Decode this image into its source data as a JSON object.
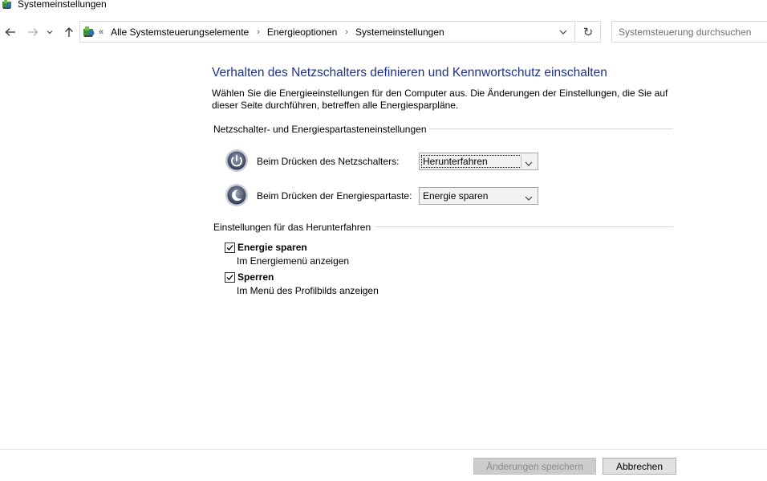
{
  "window": {
    "title": "Systemeinstellungen",
    "icon": "control-panel-icon"
  },
  "nav": {
    "back_icon": "back-arrow-icon",
    "forward_icon": "forward-arrow-icon",
    "recent_icon": "chevron-down-icon",
    "up_icon": "up-arrow-icon"
  },
  "address": {
    "overflow": "«",
    "crumbs": [
      "Alle Systemsteuerungselemente",
      "Energieoptionen",
      "Systemeinstellungen"
    ],
    "separator": "›"
  },
  "search": {
    "placeholder": "Systemsteuerung durchsuchen"
  },
  "refresh_glyph": "↻",
  "content": {
    "heading": "Verhalten des Netzschalters definieren und Kennwortschutz einschalten",
    "intro": "Wählen Sie die Energieeinstellungen für den Computer aus. Die Änderungen der Einstellungen, die Sie auf dieser Seite durchführen, betreffen alle Energiesparpläne.",
    "power_group": {
      "title": "Netzschalter- und Energiespartasteneinstellungen",
      "rows": [
        {
          "label": "Beim Drücken des Netzschalters:",
          "value": "Herunterfahren",
          "icon": "power-button-icon"
        },
        {
          "label": "Beim Drücken der Energiespartaste:",
          "value": "Energie sparen",
          "icon": "sleep-button-icon"
        }
      ]
    },
    "shutdown_group": {
      "title": "Einstellungen für das Herunterfahren",
      "options": [
        {
          "label": "Energie sparen",
          "description": "Im Energiemenü anzeigen",
          "checked": true
        },
        {
          "label": "Sperren",
          "description": "Im Menü des Profilbilds anzeigen",
          "checked": true
        }
      ]
    }
  },
  "footer": {
    "save_label": "Änderungen speichern",
    "save_enabled": false,
    "cancel_label": "Abbrechen"
  },
  "colors": {
    "heading": "#1e3287",
    "disabled_button": "#cccccc"
  }
}
